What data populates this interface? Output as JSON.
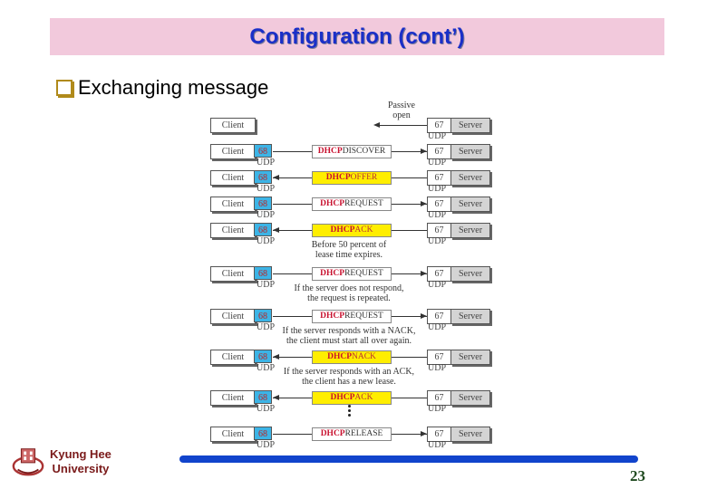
{
  "slide": {
    "title": "Configuration (cont’)",
    "bullet": "Exchanging message",
    "page_number": "23",
    "university": {
      "line1": "Kyung Hee",
      "line2": "University"
    },
    "colors": {
      "title_bg": "#f2c9dc",
      "title_text": "#1a2fc8",
      "port68": "#3cb4e6",
      "highlight": "#ffee00",
      "dhcp_red": "#c8102e",
      "footer_bar": "#1144cc"
    }
  },
  "diagram": {
    "passive_open": [
      "Passive",
      "open"
    ],
    "client_label": "Client",
    "server_label": "Server",
    "client_port": "68",
    "server_port": "67",
    "udp_label": "UDP",
    "dhcp_prefix": "DHCP",
    "rows": [
      {
        "msg": "",
        "direction": "none",
        "highlight": false,
        "note": []
      },
      {
        "msg": "DISCOVER",
        "direction": "right",
        "highlight": false,
        "note": []
      },
      {
        "msg": "OFFER",
        "direction": "left",
        "highlight": true,
        "note": []
      },
      {
        "msg": "REQUEST",
        "direction": "right",
        "highlight": false,
        "note": []
      },
      {
        "msg": "ACK",
        "direction": "left",
        "highlight": true,
        "note": [
          "Before 50 percent of",
          "lease time expires."
        ]
      },
      {
        "msg": "REQUEST",
        "direction": "right",
        "highlight": false,
        "note": [
          "If the server does not respond,",
          "the request is repeated."
        ]
      },
      {
        "msg": "REQUEST",
        "direction": "right",
        "highlight": false,
        "note": [
          "If the server responds with a NACK,",
          "the client must start all over again."
        ]
      },
      {
        "msg": "NACK",
        "direction": "left",
        "highlight": true,
        "note": [
          "If the server responds with an ACK,",
          "the client has a new lease."
        ]
      },
      {
        "msg": "ACK",
        "direction": "left",
        "highlight": true,
        "note": []
      },
      {
        "msg": "RELEASE",
        "direction": "right",
        "highlight": false,
        "note": []
      }
    ]
  }
}
